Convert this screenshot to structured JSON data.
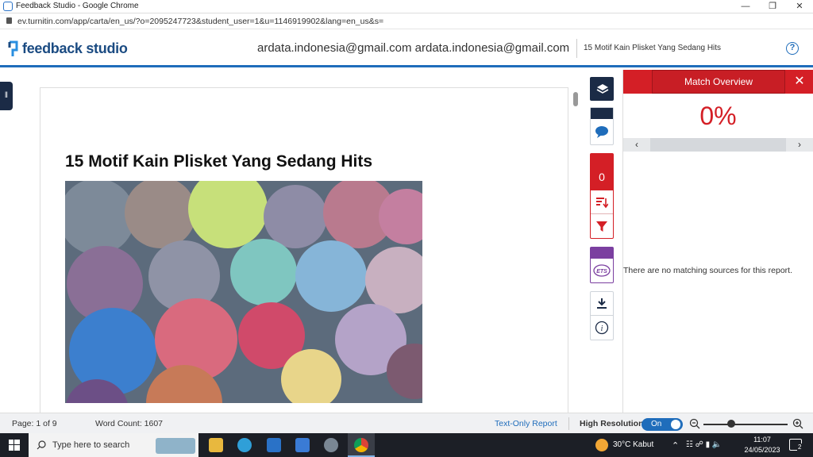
{
  "window": {
    "title": "Feedback Studio - Google Chrome",
    "url": "ev.turnitin.com/app/carta/en_us/?o=2095247723&student_user=1&u=1146919902&lang=en_us&s="
  },
  "header": {
    "logo": "feedback studio",
    "user": "ardata.indonesia@gmail.com ardata.indonesia@gmail.com",
    "doc_title": "15 Motif Kain Plisket Yang Sedang Hits",
    "help": "?"
  },
  "document": {
    "heading": "15 Motif Kain Plisket Yang Sedang Hits"
  },
  "rail": {
    "similarity_count": "0"
  },
  "panel": {
    "tab_label": "Match Overview",
    "percent": "0%",
    "empty_message": "There are no matching sources for this report."
  },
  "status": {
    "page": "Page: 1 of 9",
    "word_count": "Word Count: 1607",
    "text_only": "Text-Only Report",
    "high_res": "High Resolution",
    "toggle": "On"
  },
  "taskbar": {
    "search_placeholder": "Type here to search",
    "weather": "30°C  Kabut",
    "time": "11:07",
    "date": "24/05/2023",
    "notifications": "2"
  },
  "colors": {
    "brand_blue": "#1f6dbb",
    "match_red": "#d41f26",
    "navy": "#1b2b46",
    "ets_purple": "#7b3fa0"
  }
}
